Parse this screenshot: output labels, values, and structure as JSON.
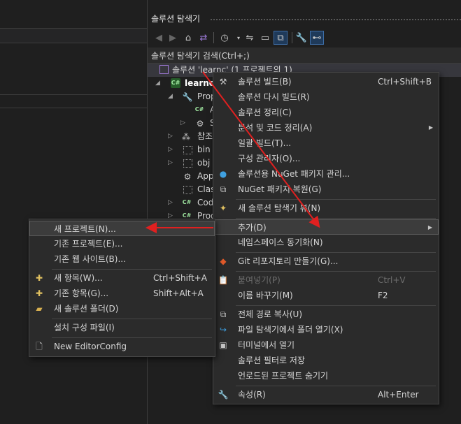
{
  "solution_explorer": {
    "title": "솔루션 탐색기",
    "search_placeholder": "솔루션 탐색기 검색(Ctrl+;)",
    "toolbar": {
      "icons": [
        "back-icon",
        "forward-icon",
        "home-icon",
        "switch-views-icon",
        "history-icon",
        "dropdown-icon",
        "sync-icon",
        "collapse-all-icon",
        "show-all-files-icon",
        "properties-wrench-icon",
        "preview-icon"
      ]
    },
    "tree": {
      "solution": "솔루션 'learnc' (1 프로젝트의 1)",
      "project": "learnc",
      "items": [
        "Prop",
        "A",
        "S",
        "참조",
        "bin",
        "obj",
        "App",
        "Clas",
        "Cod",
        "Prog"
      ]
    }
  },
  "context_menu": {
    "items": [
      {
        "label": "솔루션 빌드(B)",
        "shortcut": "Ctrl+Shift+B",
        "icon": "build-icon"
      },
      {
        "label": "솔루션 다시 빌드(R)",
        "shortcut": "",
        "icon": ""
      },
      {
        "label": "솔루션 정리(C)",
        "shortcut": "",
        "icon": ""
      },
      {
        "label": "분석 및 코드 정리(A)",
        "shortcut": "",
        "icon": "",
        "submenu": true
      },
      {
        "label": "일괄 빌드(T)...",
        "shortcut": "",
        "icon": ""
      },
      {
        "label": "구성 관리자(O)...",
        "shortcut": "",
        "icon": ""
      },
      {
        "label": "솔루션용 NuGet 패키지 관리...",
        "shortcut": "",
        "icon": "nuget-icon"
      },
      {
        "label": "NuGet 패키지 복원(G)",
        "shortcut": "",
        "icon": "restore-icon"
      },
      {
        "label": "새 솔루션 탐색기 뷰(N)",
        "shortcut": "",
        "icon": "new-view-icon"
      },
      {
        "label": "추가(D)",
        "shortcut": "",
        "icon": "",
        "submenu": true
      },
      {
        "label": "네임스페이스 동기화(N)",
        "shortcut": "",
        "icon": ""
      },
      {
        "label": "Git 리포지토리 만들기(G)...",
        "shortcut": "",
        "icon": "git-icon"
      },
      {
        "label": "붙여넣기(P)",
        "shortcut": "Ctrl+V",
        "icon": "paste-icon",
        "disabled": true
      },
      {
        "label": "이름 바꾸기(M)",
        "shortcut": "F2",
        "icon": ""
      },
      {
        "label": "전체 경로 복사(U)",
        "shortcut": "",
        "icon": "copy-icon"
      },
      {
        "label": "파일 탐색기에서 폴더 열기(X)",
        "shortcut": "",
        "icon": "open-folder-icon"
      },
      {
        "label": "터미널에서 열기",
        "shortcut": "",
        "icon": "terminal-icon"
      },
      {
        "label": "솔루션 필터로 저장",
        "shortcut": "",
        "icon": ""
      },
      {
        "label": "언로드된 프로젝트 숨기기",
        "shortcut": "",
        "icon": ""
      },
      {
        "label": "속성(R)",
        "shortcut": "Alt+Enter",
        "icon": "wrench-icon"
      }
    ]
  },
  "add_submenu": {
    "items": [
      {
        "label": "새 프로젝트(N)...",
        "shortcut": "",
        "icon": ""
      },
      {
        "label": "기존 프로젝트(E)...",
        "shortcut": "",
        "icon": ""
      },
      {
        "label": "기존 웹 사이트(B)...",
        "shortcut": "",
        "icon": ""
      },
      {
        "label": "새 항목(W)...",
        "shortcut": "Ctrl+Shift+A",
        "icon": "new-item-icon"
      },
      {
        "label": "기존 항목(G)...",
        "shortcut": "Shift+Alt+A",
        "icon": "existing-item-icon"
      },
      {
        "label": "새 솔루션 폴더(D)",
        "shortcut": "",
        "icon": "new-folder-icon"
      },
      {
        "label": "설치 구성 파일(I)",
        "shortcut": "",
        "icon": ""
      },
      {
        "label": "New EditorConfig",
        "shortcut": "",
        "icon": "editorconfig-icon"
      }
    ]
  },
  "colors": {
    "background": "#1f1f1f",
    "menu_bg": "#2b2b2b",
    "annotation_arrow": "#e02020"
  }
}
